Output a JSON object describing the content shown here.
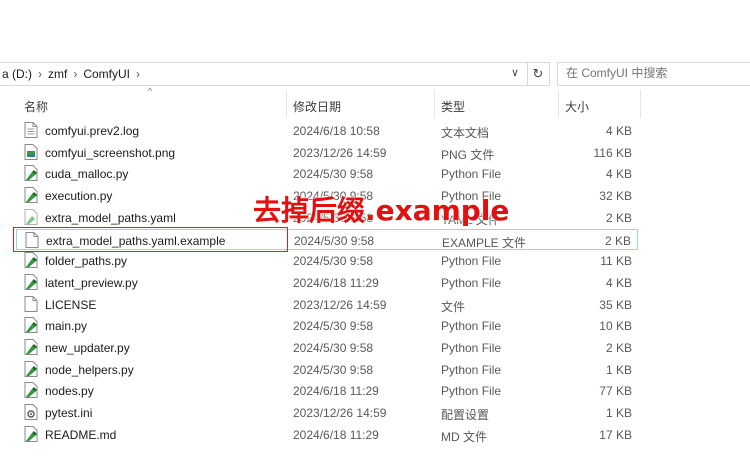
{
  "address_bar": {
    "crumbs": [
      "a (D:)",
      "zmf",
      "ComfyUI"
    ],
    "search_placeholder": "在 ComfyUI 中搜索"
  },
  "columns": {
    "name": "名称",
    "date": "修改日期",
    "type": "类型",
    "size": "大小"
  },
  "files": [
    {
      "name": "comfyui.prev2.log",
      "date": "2024/6/18 10:58",
      "type": "文本文档",
      "size": "4 KB",
      "icon": "text-file-icon"
    },
    {
      "name": "comfyui_screenshot.png",
      "date": "2023/12/26 14:59",
      "type": "PNG 文件",
      "size": "116 KB",
      "icon": "image-file-icon"
    },
    {
      "name": "cuda_malloc.py",
      "date": "2024/5/30 9:58",
      "type": "Python File",
      "size": "4 KB",
      "icon": "python-file-icon"
    },
    {
      "name": "execution.py",
      "date": "2024/5/30 9:58",
      "type": "Python File",
      "size": "32 KB",
      "icon": "python-file-icon"
    },
    {
      "name": "extra_model_paths.yaml",
      "date": "2024/5/30 9:58",
      "type": "YAML 文件",
      "size": "2 KB",
      "icon": "yaml-file-icon"
    },
    {
      "name": "extra_model_paths.yaml.example",
      "date": "2024/5/30 9:58",
      "type": "EXAMPLE 文件",
      "size": "2 KB",
      "icon": "generic-file-icon",
      "selected": true
    },
    {
      "name": "folder_paths.py",
      "date": "2024/5/30 9:58",
      "type": "Python File",
      "size": "11 KB",
      "icon": "python-file-icon"
    },
    {
      "name": "latent_preview.py",
      "date": "2024/6/18 11:29",
      "type": "Python File",
      "size": "4 KB",
      "icon": "python-file-icon"
    },
    {
      "name": "LICENSE",
      "date": "2023/12/26 14:59",
      "type": "文件",
      "size": "35 KB",
      "icon": "generic-file-icon"
    },
    {
      "name": "main.py",
      "date": "2024/5/30 9:58",
      "type": "Python File",
      "size": "10 KB",
      "icon": "python-file-icon"
    },
    {
      "name": "new_updater.py",
      "date": "2024/5/30 9:58",
      "type": "Python File",
      "size": "2 KB",
      "icon": "python-file-icon"
    },
    {
      "name": "node_helpers.py",
      "date": "2024/5/30 9:58",
      "type": "Python File",
      "size": "1 KB",
      "icon": "python-file-icon"
    },
    {
      "name": "nodes.py",
      "date": "2024/6/18 11:29",
      "type": "Python File",
      "size": "77 KB",
      "icon": "python-file-icon"
    },
    {
      "name": "pytest.ini",
      "date": "2023/12/26 14:59",
      "type": "配置设置",
      "size": "1 KB",
      "icon": "settings-file-icon"
    },
    {
      "name": "README.md",
      "date": "2024/6/18 11:29",
      "type": "MD 文件",
      "size": "17 KB",
      "icon": "python-file-icon"
    }
  ],
  "annotation_text": "去掉后缀.example",
  "colors": {
    "annotation": "#e31010",
    "selection_border": "#99d1ff",
    "python_icon": "#2e9b3d"
  }
}
